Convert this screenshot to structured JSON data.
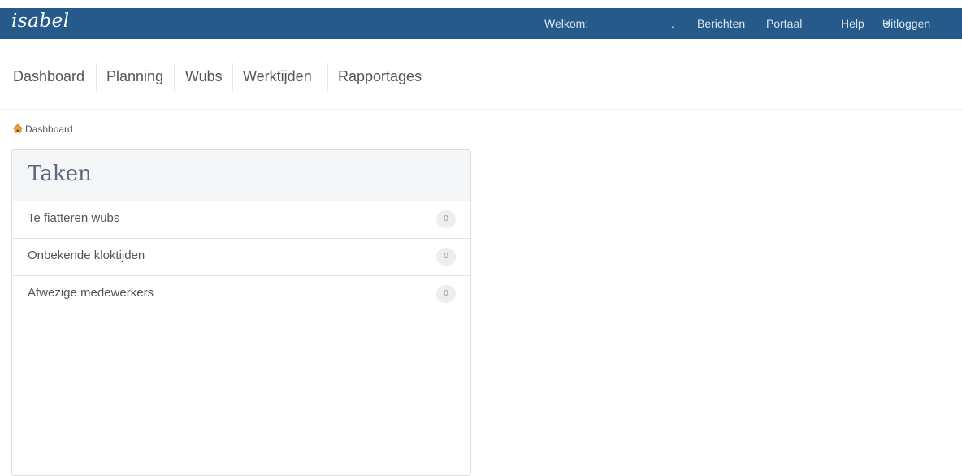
{
  "header": {
    "logo": "isabel",
    "welcome": "Welkom:",
    "user_name": ".",
    "messages": "Berichten",
    "portal": "Portaal",
    "help": "Help",
    "logout": "Uitloggen",
    "logout_icon": "logout-icon",
    "background_color": "#255a8a"
  },
  "nav": {
    "items": [
      {
        "label": "Dashboard"
      },
      {
        "label": "Planning"
      },
      {
        "label": "Wubs"
      },
      {
        "label": "Werktijden"
      },
      {
        "label": "Rapportages"
      }
    ]
  },
  "breadcrumb": {
    "icon": "home-icon",
    "label": "Dashboard"
  },
  "tasks": {
    "title": "Taken",
    "items": [
      {
        "label": "Te fiatteren wubs",
        "count": "0"
      },
      {
        "label": "Onbekende kloktijden",
        "count": "0"
      },
      {
        "label": "Afwezige medewerkers",
        "count": "0"
      }
    ]
  }
}
